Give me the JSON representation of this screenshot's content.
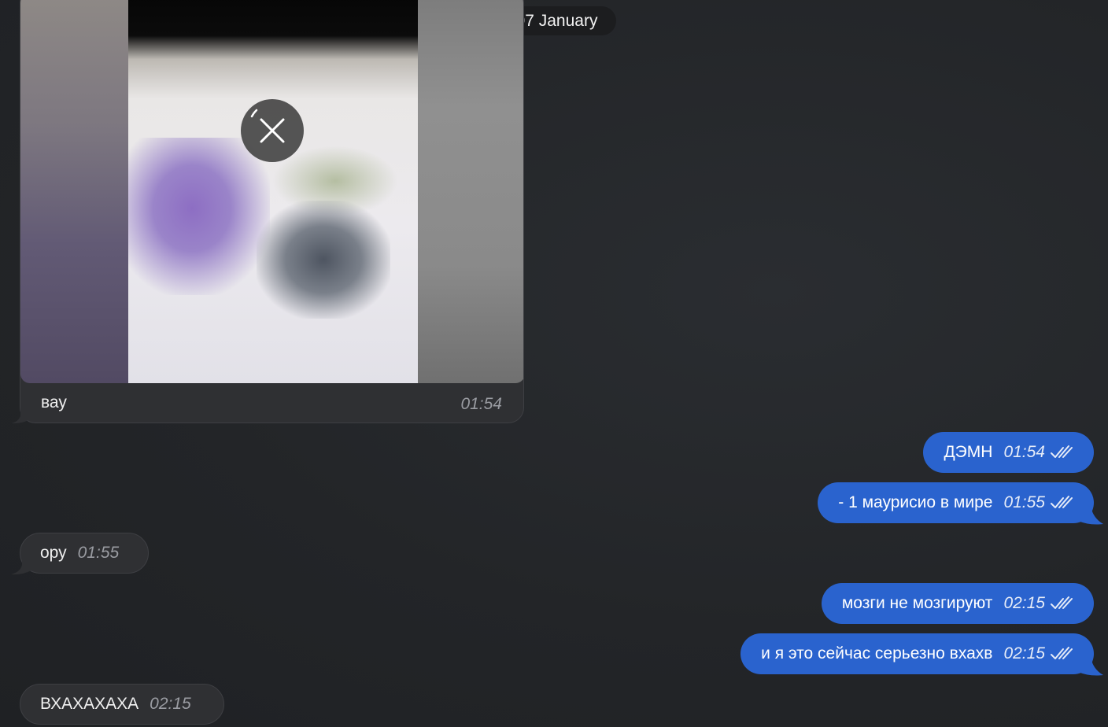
{
  "date_separator": "07 January",
  "colors": {
    "incoming_bubble": "#2f3033",
    "outgoing_bubble": "#2a63ce",
    "background": "#232528"
  },
  "media_message": {
    "caption": "вау",
    "time": "01:54",
    "overlay_icon": "cancel-download-icon"
  },
  "incoming": [
    {
      "text": "ору",
      "time": "01:55"
    },
    {
      "text": "ВХАХАХАХА",
      "time": "02:15"
    }
  ],
  "outgoing": [
    {
      "text": "ДЭМН",
      "time": "01:54",
      "status": "read"
    },
    {
      "text": "- 1 маурисио в мире",
      "time": "01:55",
      "status": "read"
    },
    {
      "text": "мозги не мозгируют",
      "time": "02:15",
      "status": "read"
    },
    {
      "text": "и я это сейчас серьезно вхахв",
      "time": "02:15",
      "status": "read"
    }
  ]
}
